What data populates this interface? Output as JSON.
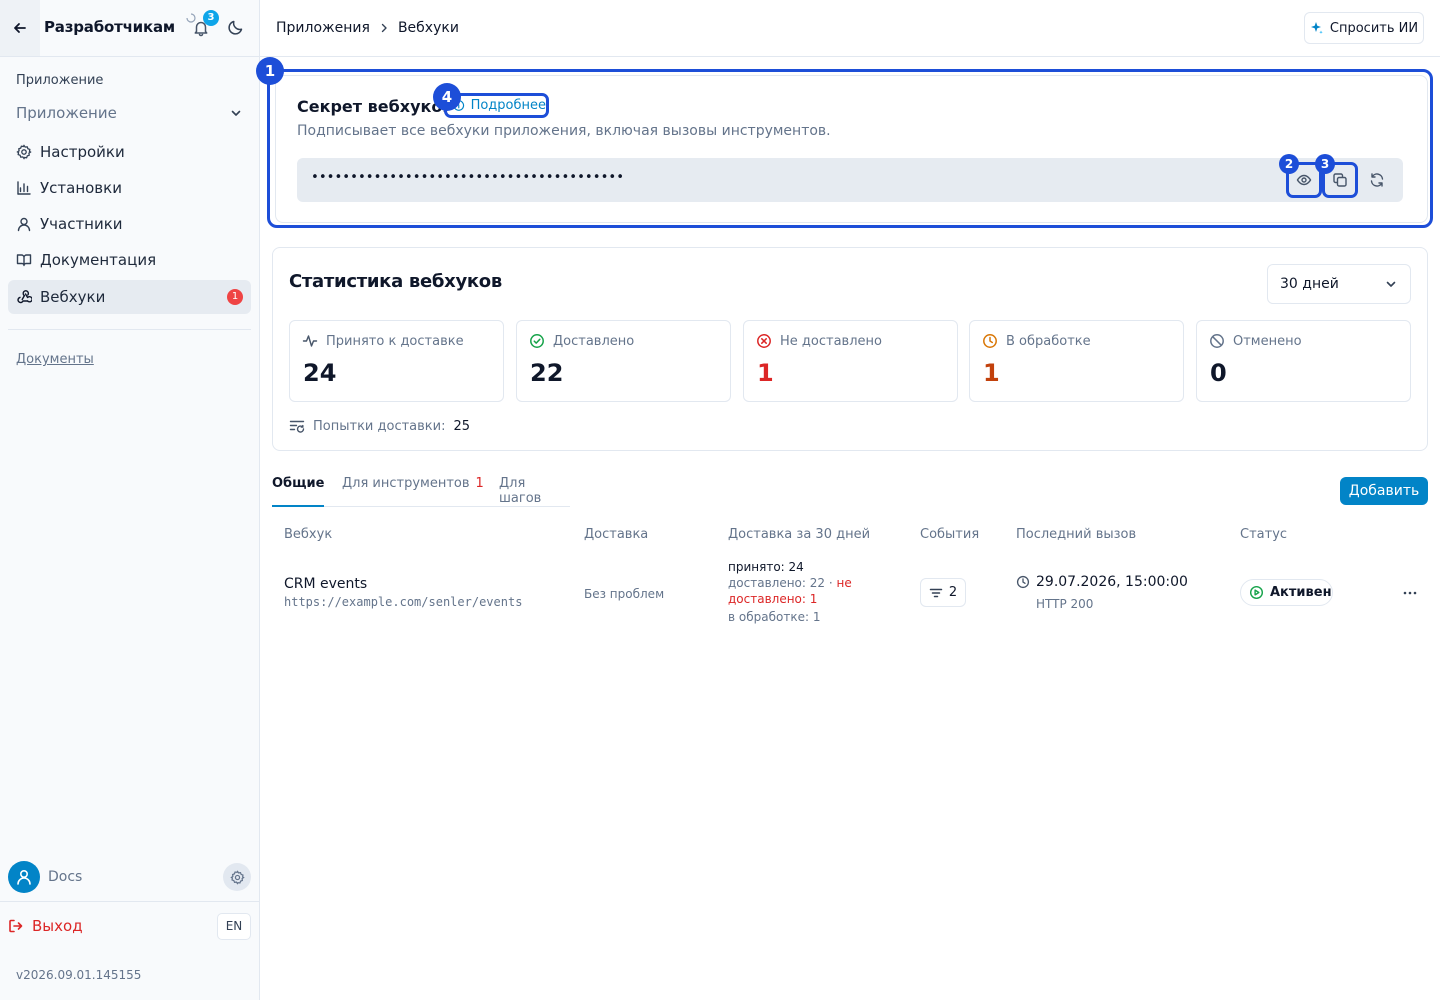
{
  "sidebar": {
    "title": "Разработчикам",
    "notifications_count": "3",
    "section_label": "Приложение",
    "app_select": "Приложение",
    "items": [
      {
        "label": "Настройки",
        "icon": "gear-icon"
      },
      {
        "label": "Установки",
        "icon": "bar-chart-icon"
      },
      {
        "label": "Участники",
        "icon": "user-icon"
      },
      {
        "label": "Документация",
        "icon": "book-icon"
      },
      {
        "label": "Вебхуки",
        "icon": "webhook-icon",
        "badge": "1",
        "active": true
      }
    ],
    "docs_link": "Документы",
    "user_name": "Docs",
    "logout": "Выход",
    "lang": "EN",
    "version": "v2026.09.01.145155"
  },
  "breadcrumb": [
    "Приложения",
    "Вебхуки"
  ],
  "ask_ai": "Спросить ИИ",
  "secret": {
    "title": "Секрет вебхуков",
    "more": "Подробнее",
    "description": "Подписывает все вебхуки приложения, включая вызовы инструментов.",
    "masked_value": "••••••••••••••••••••••••••••••••••••••••"
  },
  "markers": [
    "1",
    "2",
    "3",
    "4"
  ],
  "stats": {
    "title": "Статистика вебхуков",
    "period": "30 дней",
    "cards": [
      {
        "label": "Принято к доставке",
        "value": "24",
        "icon": "activity-icon",
        "color": "#0f172a"
      },
      {
        "label": "Доставлено",
        "value": "22",
        "icon": "check-circle-icon",
        "color": "#0f172a"
      },
      {
        "label": "Не доставлено",
        "value": "1",
        "icon": "x-circle-icon",
        "color": "#dc2626"
      },
      {
        "label": "В обработке",
        "value": "1",
        "icon": "clock-icon",
        "color": "#c2410c"
      },
      {
        "label": "Отменено",
        "value": "0",
        "icon": "ban-icon",
        "color": "#0f172a"
      }
    ],
    "attempts_label": "Попытки доставки:",
    "attempts_value": "25"
  },
  "tabs": [
    {
      "label": "Общие",
      "active": true
    },
    {
      "label": "Для инструментов",
      "count": "1"
    },
    {
      "label": "Для шагов"
    }
  ],
  "add_button": "Добавить",
  "table": {
    "headers": [
      "Вебхук",
      "Доставка",
      "Доставка за 30 дней",
      "События",
      "Последний вызов",
      "Статус"
    ],
    "row": {
      "name": "CRM events",
      "url": "https://example.com/senler/events",
      "delivery": "Без проблем",
      "d30_accepted": "принято: 24",
      "d30_delivered": "доставлено: 22 · ",
      "d30_not_delivered": "не доставлено: 1",
      "d30_processing": "в обработке: 1",
      "events": "2",
      "last_call": "29.07.2026, 15:00:00",
      "http": "HTTP 200",
      "status": "Активен"
    }
  },
  "colors": {
    "accent": "#0284c7",
    "highlight": "#1d4ed8",
    "danger": "#dc2626",
    "warning": "#c2410c",
    "success": "#16a34a"
  }
}
